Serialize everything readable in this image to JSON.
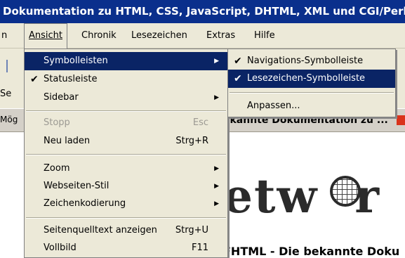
{
  "window": {
    "title": "Dokumentation zu HTML, CSS, JavaScript, DHTML, XML und CGI/Perl -"
  },
  "menubar": {
    "items": [
      {
        "label": "n"
      },
      {
        "label": "Ansicht"
      },
      {
        "label": "Chronik"
      },
      {
        "label": "Lesezeichen"
      },
      {
        "label": "Extras"
      },
      {
        "label": "Hilfe"
      }
    ]
  },
  "background": {
    "left_fragment_1": "Se",
    "left_fragment_2": "Mög",
    "tab_title": "ekannte Dokumentation zu ...",
    "logo_text": "etw",
    "logo_text_end": "r",
    "bottom_text": "FHTML - Die bekannte Doku"
  },
  "view_menu": {
    "items": [
      {
        "label": "Symbolleisten",
        "submenu": true,
        "highlighted": true
      },
      {
        "label": "Statusleiste",
        "checked": true
      },
      {
        "label": "Sidebar",
        "submenu": true
      },
      {
        "label": "Stopp",
        "shortcut": "Esc",
        "disabled": true
      },
      {
        "label": "Neu laden",
        "shortcut": "Strg+R"
      },
      {
        "label": "Zoom",
        "submenu": true
      },
      {
        "label": "Webseiten-Stil",
        "submenu": true
      },
      {
        "label": "Zeichenkodierung",
        "submenu": true
      },
      {
        "label": "Seitenquelltext anzeigen",
        "shortcut": "Strg+U"
      },
      {
        "label": "Vollbild",
        "shortcut": "F11"
      }
    ]
  },
  "toolbars_submenu": {
    "items": [
      {
        "label": "Navigations-Symbolleiste",
        "checked": true
      },
      {
        "label": "Lesezeichen-Symbolleiste",
        "checked": true,
        "highlighted": true
      },
      {
        "label": "Anpassen..."
      }
    ]
  },
  "icons": {
    "check": "✔",
    "arrow": "▶"
  },
  "colors": {
    "titlebar": "#0a2f8c",
    "highlight": "#0a2465",
    "menu_bg": "#ece9d8"
  }
}
